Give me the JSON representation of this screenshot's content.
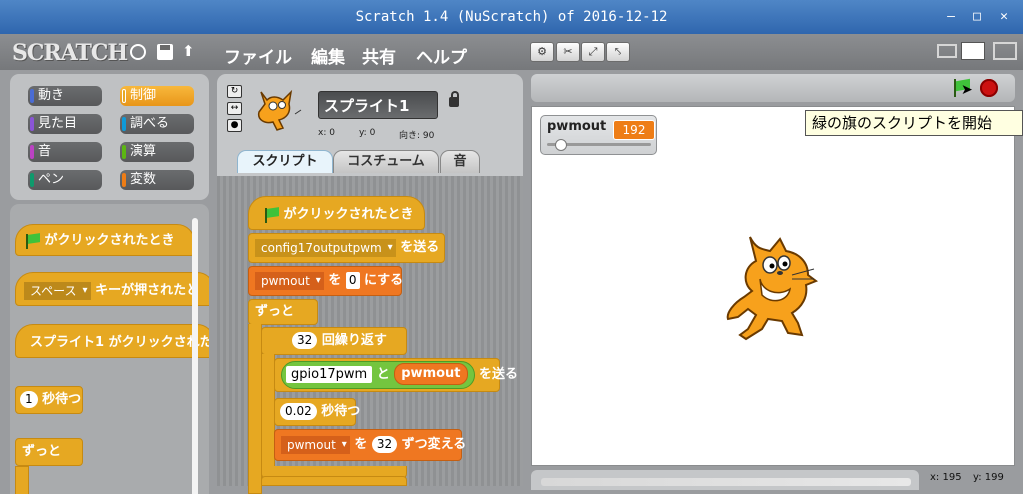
{
  "window": {
    "title": "Scratch 1.4 (NuScratch) of 2016-12-12"
  },
  "menubar": {
    "logo": "SCRATCH",
    "file": "ファイル",
    "edit": "編集",
    "share": "共有",
    "help": "ヘルプ"
  },
  "categories": [
    {
      "label": "動き",
      "color": "#4a6cd4"
    },
    {
      "label": "制御",
      "color": "#e6a822"
    },
    {
      "label": "見た目",
      "color": "#8a55d7"
    },
    {
      "label": "調べる",
      "color": "#0e9ad8"
    },
    {
      "label": "音",
      "color": "#bb42c3"
    },
    {
      "label": "演算",
      "color": "#5cb712"
    },
    {
      "label": "ペン",
      "color": "#0e9a6c"
    },
    {
      "label": "変数",
      "color": "#ee7d16"
    }
  ],
  "palette_blocks": {
    "green_flag_hat": "がクリックされたとき",
    "key_hat_key": "スペース",
    "key_hat_text": "キーが押されたと",
    "sprite_click_hat": "スプライト1 がクリックされた",
    "wait_value": "1",
    "wait_label": "秒待つ",
    "forever_label": "ずっと"
  },
  "sprite": {
    "name": "スプライト1",
    "x_label": "x: 0",
    "y_label": "y: 0",
    "dir_label": "向き: 90"
  },
  "tabs": {
    "scripts": "スクリプト",
    "costumes": "コスチューム",
    "sounds": "音"
  },
  "script": {
    "hat": "がクリックされたとき",
    "broadcast_msg": "config17outputpwm",
    "broadcast_label": "を送る",
    "setvar_var": "pwmout",
    "setvar_mid": "を",
    "setvar_val": "0",
    "setvar_end": "にする",
    "forever": "ずっと",
    "repeat_count": "32",
    "repeat_label": "回繰り返す",
    "join_left": "gpio17pwm",
    "join_mid": "と",
    "join_right": "pwmout",
    "join_end": "を送る",
    "wait_value": "0.02",
    "wait_label": "秒待つ",
    "change_var": "pwmout",
    "change_mid": "を",
    "change_val": "32",
    "change_end": "ずつ変える"
  },
  "stage": {
    "monitor_name": "pwmout",
    "monitor_value": "192",
    "tooltip": "緑の旗のスクリプトを開始",
    "mouse_x": "x: 195",
    "mouse_y": "y: 199"
  }
}
